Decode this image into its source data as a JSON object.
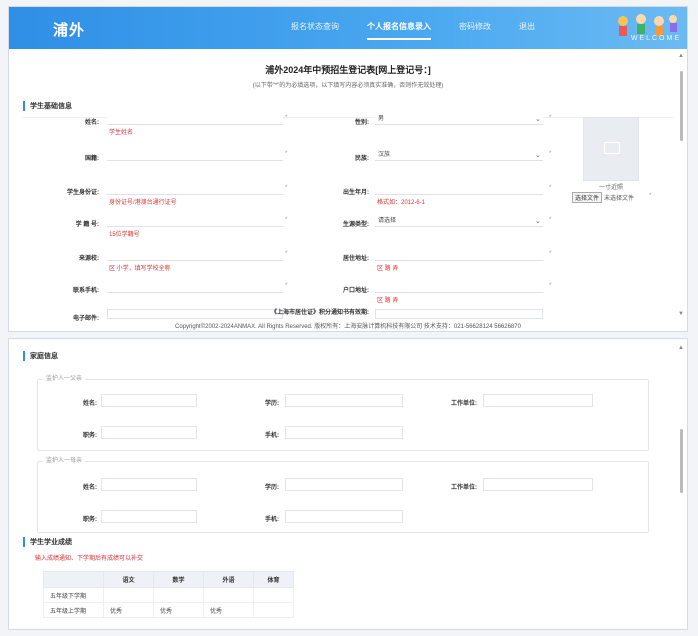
{
  "nav": {
    "brand": "浦外",
    "items": [
      "报名状态查询",
      "个人报名信息录入",
      "密码修改",
      "退出"
    ],
    "active_index": 1,
    "welcome": "WELCOME"
  },
  "form": {
    "title": "浦外2024年中预招生登记表[网上登记号：]",
    "subtitle": "(以下带\"*\"的为必填选项，以下填写内容必须真实准确，否则作无效处理)"
  },
  "student_section": {
    "heading": "学生基础信息",
    "name_label": "姓名:",
    "name_hint": "学生姓名",
    "gender_label": "性别:",
    "gender_value": "男",
    "nationality_label": "国籍:",
    "ethnicity_label": "民族:",
    "ethnicity_value": "汉族",
    "id_label": "学生身份证:",
    "id_hint": "身份证号/港澳台通行证号",
    "birth_label": "出生年月:",
    "birth_hint": "格式如：2012-6-1",
    "student_no_label": "学 籍 号:",
    "student_no_hint": "15位学籍号",
    "source_label": "生源类型:",
    "source_value": "请选择",
    "school_label": "来源校:",
    "school_hint": "区 小学，填写学校全称",
    "home_label": "居住地址:",
    "home_hint": "区 路 弄",
    "phone_label": "联系手机:",
    "hukou_label": "户口地址:",
    "hukou_hint": "区 路 弄",
    "email_label": "电子邮件:",
    "permit_label": "《上海市居住证》积分通知书有效期:"
  },
  "photo": {
    "caption": "一寸近照",
    "upload_button": "选择文件",
    "upload_status": "未选择文件"
  },
  "footer": "Copyright©2002-2024ANMAX. All Rights Reserved. 版权所有：上海安脉计算机科技有限公司    技术支持：021-56628124 56626870",
  "family_section": {
    "heading": "家庭信息",
    "guardian1": "监护人一父亲",
    "guardian2": "监护人一母亲",
    "name_label": "姓名:",
    "edu_label": "学历:",
    "work_label": "工作单位:",
    "job_label": "职务:",
    "mobile_label": "手机:"
  },
  "grades_section": {
    "heading": "学生学业成绩",
    "note": "输入成绩通知、下学期后有成绩可以补交",
    "columns": [
      "",
      "语文",
      "数学",
      "外语",
      "体育"
    ],
    "rows": [
      [
        "五年级下学期",
        "",
        "",
        "",
        ""
      ],
      [
        "五年级上学期",
        "优秀",
        "优秀",
        "优秀",
        ""
      ]
    ]
  }
}
